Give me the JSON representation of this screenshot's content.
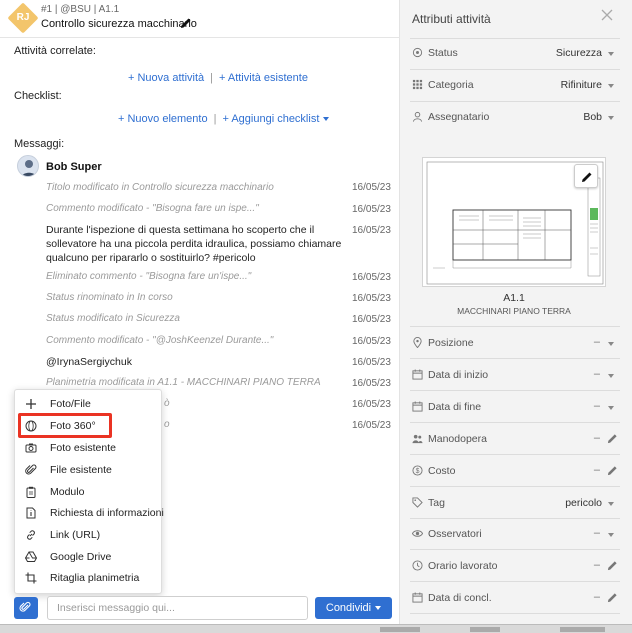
{
  "header": {
    "avatar_initials": "RJ",
    "meta": "#1 | @BSU | A1.1",
    "title": "Controllo sicurezza macchinario"
  },
  "related": {
    "label": "Attività correlate:",
    "new_link": "+ Nuova attività",
    "existing_link": "+ Attività esistente"
  },
  "checklist": {
    "label": "Checklist:",
    "new_link": "+ Nuovo elemento",
    "add_link": "+ Aggiungi checklist"
  },
  "messages": {
    "label": "Messaggi:",
    "author": "Bob Super",
    "items": [
      {
        "text": "Titolo modificato in Controllo sicurezza macchinario",
        "date": "16/05/23"
      },
      {
        "text": "Commento modificato - \"Bisogna fare un ispe...\"",
        "date": "16/05/23"
      },
      {
        "text": "Durante l'ispezione di questa settimana ho scoperto che il sollevatore ha una piccola perdita idraulica, possiamo chiamare qualcuno per ripararlo o sostituirlo? #pericolo",
        "date": "16/05/23"
      },
      {
        "text": "Eliminato commento - \"Bisogna fare un'ispe...\"",
        "date": "16/05/23"
      },
      {
        "text": "Status rinominato in In corso",
        "date": "16/05/23"
      },
      {
        "text": "Status modificato in Sicurezza",
        "date": "16/05/23"
      },
      {
        "text": "Commento modificato - \"@JoshKeenzel Durante...\"",
        "date": "16/05/23"
      },
      {
        "text": "@IrynaSergiychuk",
        "date": "16/05/23"
      },
      {
        "text": "Planimetria modificata in A1.1 - MACCHINARI PIANO TERRA",
        "date": "16/05/23"
      },
      {
        "text": "ò",
        "date": "16/05/23"
      },
      {
        "text": "o",
        "date": "16/05/23"
      }
    ]
  },
  "attach_menu": {
    "items": [
      {
        "label": "Foto/File",
        "icon": "plus-icon"
      },
      {
        "label": "Foto 360°",
        "icon": "panorama-360-icon"
      },
      {
        "label": "Foto esistente",
        "icon": "camera-icon"
      },
      {
        "label": "File esistente",
        "icon": "paperclip-icon"
      },
      {
        "label": "Modulo",
        "icon": "clipboard-icon"
      },
      {
        "label": "Richiesta di informazioni",
        "icon": "info-document-icon"
      },
      {
        "label": "Link (URL)",
        "icon": "link-icon"
      },
      {
        "label": "Google Drive",
        "icon": "google-drive-icon"
      },
      {
        "label": "Ritaglia planimetria",
        "icon": "crop-icon"
      }
    ]
  },
  "composer": {
    "placeholder": "Inserisci messaggio qui...",
    "share_label": "Condividi"
  },
  "attributes": {
    "title": "Attributi attività",
    "status": {
      "label": "Status",
      "value": "Sicurezza"
    },
    "category": {
      "label": "Categoria",
      "value": "Rifiniture"
    },
    "assignee": {
      "label": "Assegnatario",
      "value": "Bob"
    },
    "plan": {
      "code": "A1.1",
      "name": "MACCHINARI PIANO TERRA"
    },
    "position": {
      "label": "Posizione",
      "value": "–"
    },
    "start_date": {
      "label": "Data di inizio",
      "value": "–"
    },
    "end_date": {
      "label": "Data di fine",
      "value": "–"
    },
    "labor": {
      "label": "Manodopera",
      "value": "–"
    },
    "cost": {
      "label": "Costo",
      "value": "–"
    },
    "tag": {
      "label": "Tag",
      "value": "pericolo"
    },
    "observers": {
      "label": "Osservatori",
      "value": "–"
    },
    "hours": {
      "label": "Orario lavorato",
      "value": "–"
    },
    "completion_date": {
      "label": "Data di concl.",
      "value": "–"
    }
  },
  "colors": {
    "accent": "#2f6fd1",
    "highlight": "#ea3323",
    "badge": "#f3c56b"
  }
}
